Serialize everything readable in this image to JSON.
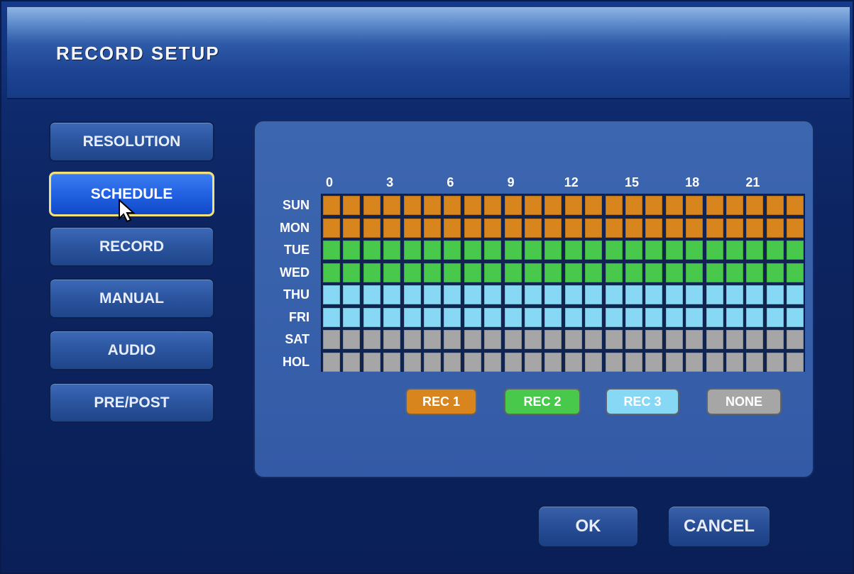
{
  "window": {
    "title": "RECORD SETUP"
  },
  "menu": [
    {
      "label": "RESOLUTION",
      "active": false
    },
    {
      "label": "SCHEDULE",
      "active": true
    },
    {
      "label": "RECORD",
      "active": false
    },
    {
      "label": "MANUAL",
      "active": false
    },
    {
      "label": "AUDIO",
      "active": false
    },
    {
      "label": "PRE/POST",
      "active": false
    }
  ],
  "schedule": {
    "hour_labels": [
      "0",
      "3",
      "6",
      "9",
      "12",
      "15",
      "18",
      "21"
    ],
    "days": [
      "SUN",
      "MON",
      "TUE",
      "WED",
      "THU",
      "FRI",
      "SAT",
      "HOL"
    ],
    "day_modes": [
      "rec1",
      "rec1",
      "rec2",
      "rec2",
      "rec3",
      "rec3",
      "none",
      "none"
    ],
    "hours_per_day": 24
  },
  "legend": [
    {
      "key": "rec1",
      "label": "REC 1",
      "color": "#d8851d"
    },
    {
      "key": "rec2",
      "label": "REC 2",
      "color": "#49c94b"
    },
    {
      "key": "rec3",
      "label": "REC 3",
      "color": "#87d8f4"
    },
    {
      "key": "none",
      "label": "NONE",
      "color": "#a6a6a6"
    }
  ],
  "actions": {
    "ok_label": "OK",
    "cancel_label": "CANCEL"
  }
}
